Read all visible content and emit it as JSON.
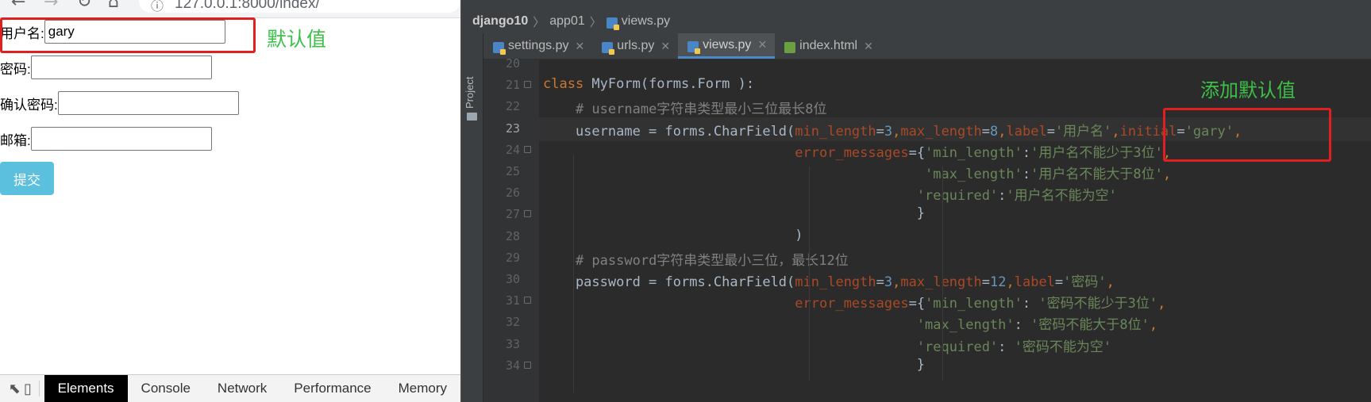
{
  "browser": {
    "url": "127.0.0.1:8000/index/",
    "form": {
      "username_label": "用户名:",
      "username_value": "gary",
      "password_label": "密码:",
      "confirm_label": "确认密码:",
      "email_label": "邮箱:",
      "submit_label": "提交"
    },
    "annotation": "默认值",
    "devtools_tabs": [
      "Elements",
      "Console",
      "Network",
      "Performance",
      "Memory"
    ],
    "devtools_active_tab": "Elements"
  },
  "ide": {
    "breadcrumb": [
      "django10",
      "app01",
      "views.py"
    ],
    "side_panel_label": "Project",
    "tabs": [
      {
        "label": "settings.py",
        "active": false
      },
      {
        "label": "urls.py",
        "active": false
      },
      {
        "label": "views.py",
        "active": true
      },
      {
        "label": "index.html",
        "active": false
      }
    ],
    "current_line": 23,
    "annotation": "添加默认值",
    "code_lines": [
      {
        "num": 20,
        "html": ""
      },
      {
        "num": 21,
        "html": "<span class=\"kw\">class</span> MyForm(forms.Form ):"
      },
      {
        "num": 22,
        "html": "    <span class=\"cm\"># username字符串类型最小三位最长8位</span>"
      },
      {
        "num": 23,
        "html": "    username = forms.CharField(<span class=\"pn\">min_length</span>=<span class=\"nu\">3</span><span class=\"kw\">,</span><span class=\"pn\">max_length</span>=<span class=\"nu\">8</span><span class=\"kw\">,</span><span class=\"pn\">label</span>=<span class=\"st\">'用户名'</span><span class=\"kw\">,</span><span class=\"pn\">initial</span>=<span class=\"st\">'gary'</span><span class=\"kw\">,</span>"
      },
      {
        "num": 24,
        "html": "                               <span class=\"pn\">error_messages</span>={<span class=\"st\">'min_length'</span>:<span class=\"st\">'用户名不能少于3位'</span><span class=\"kw\">,</span>"
      },
      {
        "num": 25,
        "html": "                                               <span class=\"st\">'max_length'</span>:<span class=\"st\">'用户名不能大于8位'</span><span class=\"kw\">,</span>"
      },
      {
        "num": 26,
        "html": "                                              <span class=\"st\">'required'</span>:<span class=\"st\">'用户名不能为空'</span>"
      },
      {
        "num": 27,
        "html": "                                              }"
      },
      {
        "num": 28,
        "html": "                               )"
      },
      {
        "num": 29,
        "html": "    <span class=\"cm\"># password字符串类型最小三位，最长12位</span>"
      },
      {
        "num": 30,
        "html": "    password = forms.CharField(<span class=\"pn\">min_length</span>=<span class=\"nu\">3</span><span class=\"kw\">,</span><span class=\"pn\">max_length</span>=<span class=\"nu\">12</span><span class=\"kw\">,</span><span class=\"pn\">label</span>=<span class=\"st\">'密码'</span><span class=\"kw\">,</span>"
      },
      {
        "num": 31,
        "html": "                               <span class=\"pn\">error_messages</span>={<span class=\"st\">'min_length'</span>: <span class=\"st\">'密码不能少于3位'</span><span class=\"kw\">,</span>"
      },
      {
        "num": 32,
        "html": "                                              <span class=\"st\">'max_length'</span>: <span class=\"st\">'密码不能大于8位'</span><span class=\"kw\">,</span>"
      },
      {
        "num": 33,
        "html": "                                              <span class=\"st\">'required'</span>: <span class=\"st\">'密码不能为空'</span>"
      },
      {
        "num": 34,
        "html": "                                              }"
      }
    ]
  }
}
